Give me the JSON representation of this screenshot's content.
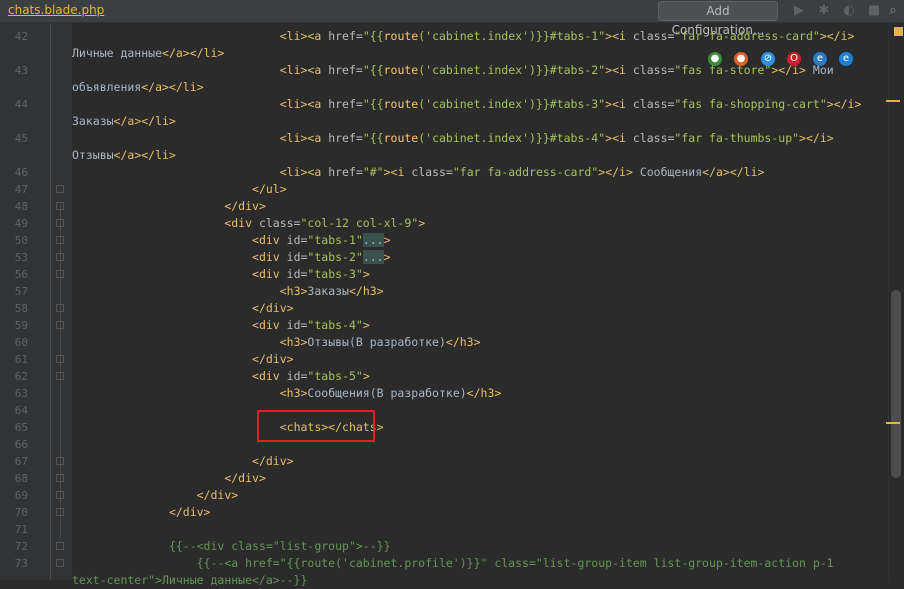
{
  "tab": {
    "file_name": "chats.blade.php"
  },
  "toolbar": {
    "add_configuration_label": "Add Configuration..."
  },
  "lines": [
    {
      "num": "42",
      "parts": [
        [
          "text",
          "                              "
        ],
        [
          "tag",
          "<li><a "
        ],
        [
          "attr",
          "href="
        ],
        [
          "str",
          "\"{{"
        ],
        [
          "fn",
          "route"
        ],
        [
          "str",
          "('cabinet.index')}}#tabs-1\""
        ],
        [
          "tag",
          ">"
        ],
        [
          "tag",
          "<i "
        ],
        [
          "attr",
          "class="
        ],
        [
          "str",
          "\"far fa-address-card\""
        ],
        [
          "tag",
          "></i>"
        ]
      ]
    },
    {
      "num": "",
      "parts": [
        [
          "text",
          "Личные данные"
        ],
        [
          "tag",
          "</a></li>"
        ]
      ]
    },
    {
      "num": "43",
      "parts": [
        [
          "text",
          "                              "
        ],
        [
          "tag",
          "<li><a "
        ],
        [
          "attr",
          "href="
        ],
        [
          "str",
          "\"{{"
        ],
        [
          "fn",
          "route"
        ],
        [
          "str",
          "('cabinet.index')}}#tabs-2\""
        ],
        [
          "tag",
          ">"
        ],
        [
          "tag",
          "<i "
        ],
        [
          "attr",
          "class="
        ],
        [
          "str",
          "\"fas fa-store\""
        ],
        [
          "tag",
          "></i>"
        ],
        [
          "text",
          " Мои"
        ]
      ]
    },
    {
      "num": "",
      "parts": [
        [
          "text",
          "объявления"
        ],
        [
          "tag",
          "</a></li>"
        ]
      ]
    },
    {
      "num": "44",
      "parts": [
        [
          "text",
          "                              "
        ],
        [
          "tag",
          "<li><a "
        ],
        [
          "attr",
          "href="
        ],
        [
          "str",
          "\"{{"
        ],
        [
          "fn",
          "route"
        ],
        [
          "str",
          "('cabinet.index')}}#tabs-3\""
        ],
        [
          "tag",
          ">"
        ],
        [
          "tag",
          "<i "
        ],
        [
          "attr",
          "class="
        ],
        [
          "str",
          "\"fas fa-shopping-cart\""
        ],
        [
          "tag",
          "></i>"
        ]
      ]
    },
    {
      "num": "",
      "parts": [
        [
          "text",
          "Заказы"
        ],
        [
          "tag",
          "</a></li>"
        ]
      ]
    },
    {
      "num": "45",
      "parts": [
        [
          "text",
          "                              "
        ],
        [
          "tag",
          "<li><a "
        ],
        [
          "attr",
          "href="
        ],
        [
          "str",
          "\"{{"
        ],
        [
          "fn",
          "route"
        ],
        [
          "str",
          "('cabinet.index')}}#tabs-4\""
        ],
        [
          "tag",
          ">"
        ],
        [
          "tag",
          "<i "
        ],
        [
          "attr",
          "class="
        ],
        [
          "str",
          "\"far fa-thumbs-up\""
        ],
        [
          "tag",
          "></i>"
        ]
      ]
    },
    {
      "num": "",
      "parts": [
        [
          "text",
          "Отзывы"
        ],
        [
          "tag",
          "</a></li>"
        ]
      ]
    },
    {
      "num": "46",
      "parts": [
        [
          "text",
          "                              "
        ],
        [
          "tag",
          "<li><a "
        ],
        [
          "attr",
          "href="
        ],
        [
          "str",
          "\"#\""
        ],
        [
          "tag",
          ">"
        ],
        [
          "tag",
          "<i "
        ],
        [
          "attr",
          "class="
        ],
        [
          "str",
          "\"far fa-address-card\""
        ],
        [
          "tag",
          "></i>"
        ],
        [
          "text",
          " Сообщения"
        ],
        [
          "tag",
          "</a></li>"
        ]
      ]
    },
    {
      "num": "47",
      "parts": [
        [
          "text",
          "                          "
        ],
        [
          "tag",
          "</ul>"
        ]
      ]
    },
    {
      "num": "48",
      "parts": [
        [
          "text",
          "                      "
        ],
        [
          "tag",
          "</div>"
        ]
      ]
    },
    {
      "num": "49",
      "parts": [
        [
          "text",
          "                      "
        ],
        [
          "tag",
          "<div "
        ],
        [
          "attr",
          "class="
        ],
        [
          "str",
          "\"col-12 col-xl-9\""
        ],
        [
          "tag",
          ">"
        ]
      ]
    },
    {
      "num": "50",
      "parts": [
        [
          "text",
          "                          "
        ],
        [
          "tag",
          "<div "
        ],
        [
          "attr",
          "id="
        ],
        [
          "str",
          "\"tabs-1\""
        ],
        [
          "fold",
          "..."
        ],
        [
          "tag",
          ">"
        ]
      ]
    },
    {
      "num": "53",
      "parts": [
        [
          "text",
          "                          "
        ],
        [
          "tag",
          "<div "
        ],
        [
          "attr",
          "id="
        ],
        [
          "str",
          "\"tabs-2\""
        ],
        [
          "fold",
          "..."
        ],
        [
          "tag",
          ">"
        ]
      ]
    },
    {
      "num": "56",
      "parts": [
        [
          "text",
          "                          "
        ],
        [
          "tag",
          "<div "
        ],
        [
          "attr",
          "id="
        ],
        [
          "str",
          "\"tabs-3\""
        ],
        [
          "tag",
          ">"
        ]
      ]
    },
    {
      "num": "57",
      "parts": [
        [
          "text",
          "                              "
        ],
        [
          "tag",
          "<h3>"
        ],
        [
          "text",
          "Заказы"
        ],
        [
          "tag",
          "</h3>"
        ]
      ]
    },
    {
      "num": "58",
      "parts": [
        [
          "text",
          "                          "
        ],
        [
          "tag",
          "</div>"
        ]
      ]
    },
    {
      "num": "59",
      "parts": [
        [
          "text",
          "                          "
        ],
        [
          "tag",
          "<div "
        ],
        [
          "attr",
          "id="
        ],
        [
          "str",
          "\"tabs-4\""
        ],
        [
          "tag",
          ">"
        ]
      ]
    },
    {
      "num": "60",
      "parts": [
        [
          "text",
          "                              "
        ],
        [
          "tag",
          "<h3>"
        ],
        [
          "text",
          "Отзывы(В разработке)"
        ],
        [
          "tag",
          "</h3>"
        ]
      ]
    },
    {
      "num": "61",
      "parts": [
        [
          "text",
          "                          "
        ],
        [
          "tag",
          "</div>"
        ]
      ]
    },
    {
      "num": "62",
      "parts": [
        [
          "text",
          "                          "
        ],
        [
          "tag",
          "<div "
        ],
        [
          "attr",
          "id="
        ],
        [
          "str",
          "\"tabs-5\""
        ],
        [
          "tag",
          ">"
        ]
      ]
    },
    {
      "num": "63",
      "parts": [
        [
          "text",
          "                              "
        ],
        [
          "tag",
          "<h3>"
        ],
        [
          "text",
          "Сообщения(В разработке)"
        ],
        [
          "tag",
          "</h3>"
        ]
      ]
    },
    {
      "num": "64",
      "parts": [
        [
          "text",
          ""
        ]
      ]
    },
    {
      "num": "65",
      "parts": [
        [
          "text",
          "                              "
        ],
        [
          "tag",
          "<chats></chats>"
        ]
      ]
    },
    {
      "num": "66",
      "parts": [
        [
          "text",
          ""
        ]
      ]
    },
    {
      "num": "67",
      "parts": [
        [
          "text",
          "                          "
        ],
        [
          "tag",
          "</div>"
        ]
      ]
    },
    {
      "num": "68",
      "parts": [
        [
          "text",
          "                      "
        ],
        [
          "tag",
          "</div>"
        ]
      ]
    },
    {
      "num": "69",
      "parts": [
        [
          "text",
          "                  "
        ],
        [
          "tag",
          "</div>"
        ]
      ]
    },
    {
      "num": "70",
      "parts": [
        [
          "text",
          "              "
        ],
        [
          "tag",
          "</div>"
        ]
      ]
    },
    {
      "num": "71",
      "parts": [
        [
          "text",
          ""
        ]
      ]
    },
    {
      "num": "72",
      "parts": [
        [
          "text",
          "              "
        ],
        [
          "comment",
          "{{--<div class=\"list-group\">--}}"
        ]
      ]
    },
    {
      "num": "73",
      "parts": [
        [
          "text",
          "                  "
        ],
        [
          "comment",
          "{{--<a href=\"{{route('cabinet.profile')}}\" class=\"list-group-item list-group-item-action p-1"
        ]
      ]
    },
    {
      "num": "",
      "parts": [
        [
          "comment",
          "text-center\">Личные данные</a>--}}"
        ]
      ]
    }
  ]
}
